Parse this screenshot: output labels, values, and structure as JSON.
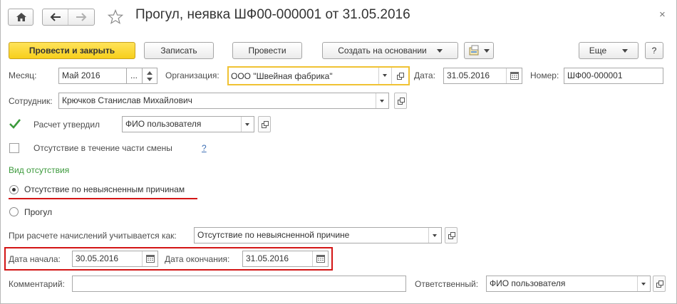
{
  "window": {
    "title": "Прогул, неявка ШФ00-000001 от 31.05.2016",
    "close_glyph": "×"
  },
  "toolbar": {
    "post_close_label": "Провести и закрыть",
    "save_label": "Записать",
    "post_label": "Провести",
    "create_based_label": "Создать на основании",
    "more_label": "Еще",
    "help_label": "?"
  },
  "header": {
    "month_label": "Месяц:",
    "month_value": "Май 2016",
    "month_ellipsis": "...",
    "org_label": "Организация:",
    "org_value": "ООО \"Швейная фабрика\"",
    "date_label": "Дата:",
    "date_value": "31.05.2016",
    "number_label": "Номер:",
    "number_value": "ШФ00-000001"
  },
  "employee": {
    "label": "Сотрудник:",
    "value": "Крючков Станислав Михайлович"
  },
  "approval": {
    "checked": true,
    "label": "Расчет утвердил",
    "value": "ФИО пользователя"
  },
  "partial_shift": {
    "checked": false,
    "label": "Отсутствие в течение части смены",
    "help": "?"
  },
  "absence_type": {
    "section_label": "Вид отсутствия",
    "options": [
      {
        "label": "Отсутствие по невыясненным причинам",
        "selected": true
      },
      {
        "label": "Прогул",
        "selected": false
      }
    ]
  },
  "accrual": {
    "label": "При расчете начислений учитывается как:",
    "value": "Отсутствие по невыясненной причине"
  },
  "period": {
    "start_label": "Дата начала:",
    "start_value": "30.05.2016",
    "end_label": "Дата окончания:",
    "end_value": "31.05.2016"
  },
  "footer": {
    "comment_label": "Комментарий:",
    "comment_value": "",
    "responsible_label": "Ответственный:",
    "responsible_value": "ФИО пользователя"
  },
  "colors": {
    "primary_button": "#f7cf1b",
    "section_label": "#3c9a3c",
    "highlight": "#d31515",
    "focus_border": "#f0c233"
  }
}
